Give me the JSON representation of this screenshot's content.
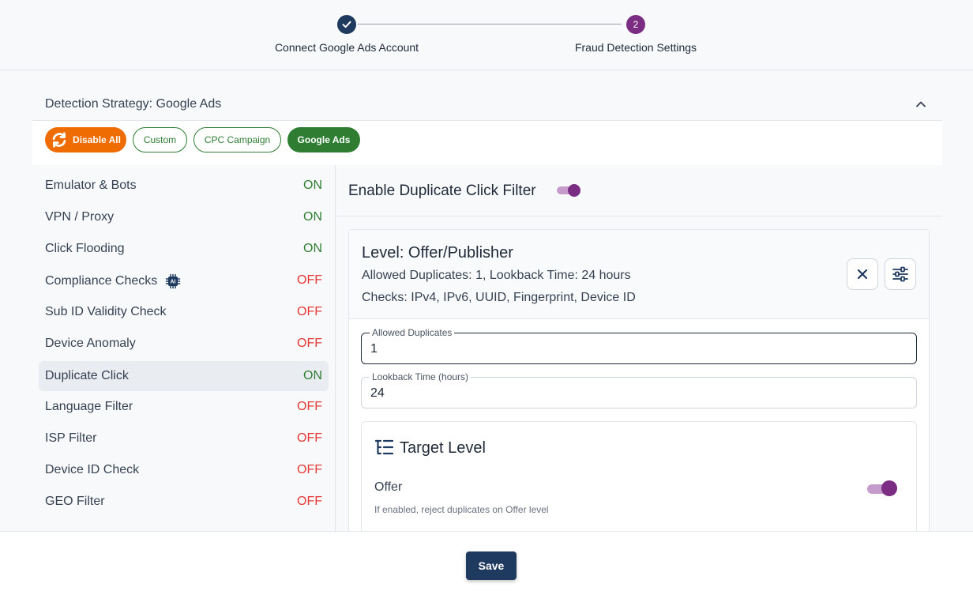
{
  "stepper": {
    "steps": [
      {
        "label": "Connect Google Ads Account",
        "state": "completed",
        "icon": "check-icon"
      },
      {
        "label": "Fraud Detection Settings",
        "state": "active",
        "number": "2"
      }
    ]
  },
  "strategy": {
    "title": "Detection Strategy: Google Ads",
    "buttons": {
      "disable_all": "Disable All",
      "custom": "Custom",
      "cpc_campaign": "CPC Campaign",
      "google_ads": "Google Ads"
    }
  },
  "rules": [
    {
      "name": "Emulator & Bots",
      "status": "ON"
    },
    {
      "name": "VPN / Proxy",
      "status": "ON"
    },
    {
      "name": "Click Flooding",
      "status": "ON"
    },
    {
      "name": "Compliance Checks",
      "status": "OFF",
      "badge": "AI"
    },
    {
      "name": "Sub ID Validity Check",
      "status": "OFF"
    },
    {
      "name": "Device Anomaly",
      "status": "OFF"
    },
    {
      "name": "Duplicate Click",
      "status": "ON",
      "selected": true
    },
    {
      "name": "Language Filter",
      "status": "OFF"
    },
    {
      "name": "ISP Filter",
      "status": "OFF"
    },
    {
      "name": "Device ID Check",
      "status": "OFF"
    },
    {
      "name": "GEO Filter",
      "status": "OFF"
    }
  ],
  "panel": {
    "title": "Enable Duplicate Click Filter",
    "enabled": true,
    "level": {
      "title": "Level: Offer/Publisher",
      "summary": "Allowed Duplicates: 1, Lookback Time: 24 hours",
      "checks": "Checks: IPv4, IPv6, UUID, Fingerprint, Device ID"
    },
    "fields": {
      "allowed_label": "Allowed Duplicates",
      "allowed_value": "1",
      "lookback_label": "Lookback Time (hours)",
      "lookback_value": "24"
    },
    "target": {
      "title": "Target Level",
      "offer_label": "Offer",
      "offer_enabled": true,
      "offer_help": "If enabled, reject duplicates on Offer level"
    }
  },
  "footer": {
    "save_label": "Save"
  },
  "colors": {
    "primary": "#1e3a5f",
    "accent": "#7b2d84",
    "success": "#2e7d32",
    "danger": "#e53935",
    "warning": "#ef6c00"
  }
}
